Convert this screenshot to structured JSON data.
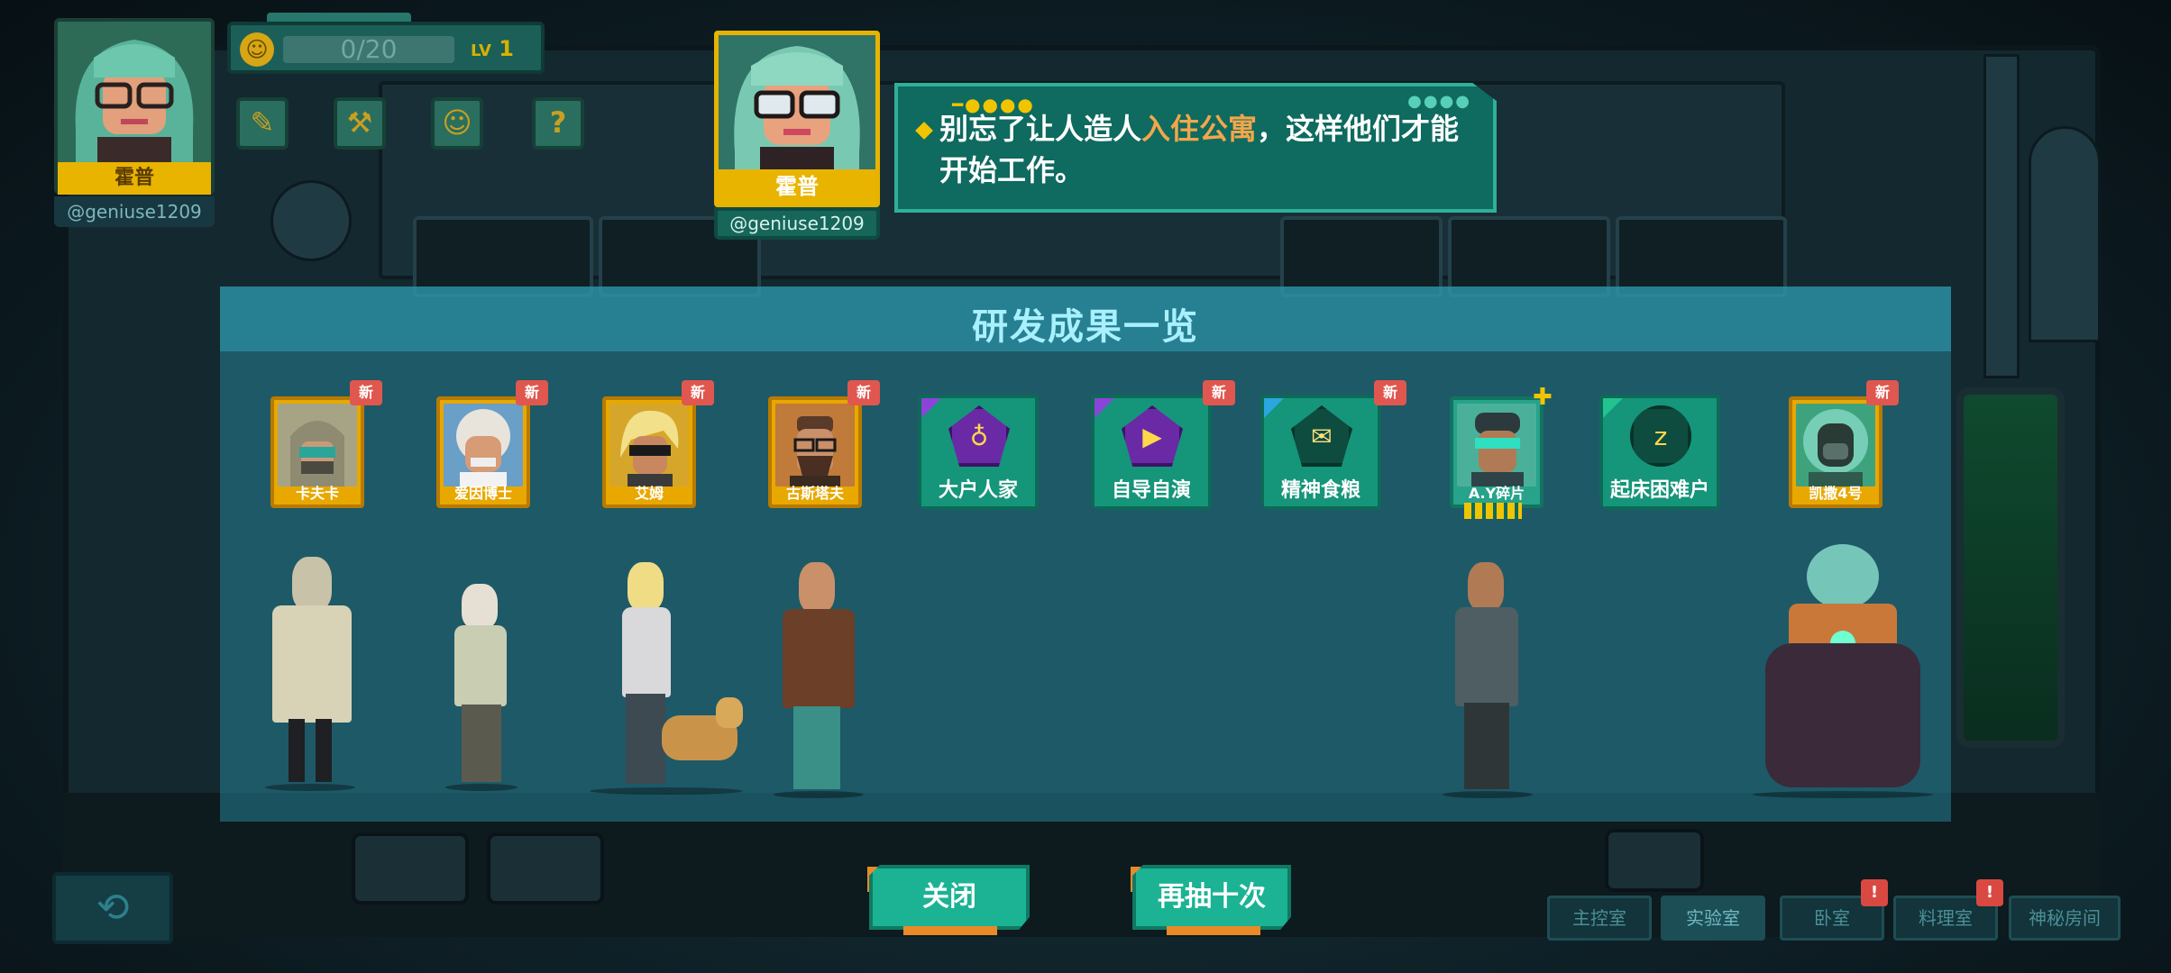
{
  "player": {
    "name": "霍普",
    "handle": "@geniuse1209",
    "xp_text": "0/20",
    "level_label": "LV",
    "level_value": "1"
  },
  "hud_buttons": [
    {
      "name": "notes-icon",
      "glyph": "✎"
    },
    {
      "name": "hammer-icon",
      "glyph": "⚒"
    },
    {
      "name": "smile-icon",
      "glyph": "☺"
    },
    {
      "name": "help-icon",
      "glyph": "?"
    }
  ],
  "speaker": {
    "name": "霍普",
    "handle": "@geniuse1209"
  },
  "dialog": {
    "text_before": "别忘了让人造人",
    "highlight": "入住公寓",
    "text_after": "，这样他们才能开始工作。"
  },
  "panel": {
    "title": "研发成果一览"
  },
  "results": [
    {
      "kind": "character",
      "label": "卡夫卡",
      "is_new": true,
      "new_label": "新",
      "color": "#8a8f7a"
    },
    {
      "kind": "character",
      "label": "爱因博士",
      "is_new": true,
      "new_label": "新",
      "color": "#c9a27a"
    },
    {
      "kind": "character",
      "label": "艾姆",
      "is_new": true,
      "new_label": "新",
      "color": "#d8b640"
    },
    {
      "kind": "character",
      "label": "古斯塔夫",
      "is_new": true,
      "new_label": "新",
      "color": "#6b4a3a"
    },
    {
      "kind": "trait",
      "label": "大户人家",
      "is_new": false,
      "glyph": "♁",
      "corner": "purple"
    },
    {
      "kind": "trait",
      "label": "自导自演",
      "is_new": true,
      "new_label": "新",
      "glyph": "▶",
      "corner": "purple"
    },
    {
      "kind": "trait",
      "label": "精神食粮",
      "is_new": true,
      "new_label": "新",
      "glyph": "✉",
      "corner": "blue"
    },
    {
      "kind": "character",
      "label": "A.Y碎片",
      "is_new": false,
      "color": "#3f8f86"
    },
    {
      "kind": "trait",
      "label": "起床困难户",
      "is_new": false,
      "glyph": "z",
      "corner": "green"
    },
    {
      "kind": "character",
      "label": "凯撒4号",
      "is_new": true,
      "new_label": "新",
      "color": "#3a7a5a"
    }
  ],
  "buttons": {
    "close": "关闭",
    "draw_ten": "再抽十次"
  },
  "corner_button": {
    "icon": "globe-return-icon",
    "glyph": "⟲"
  },
  "rooms": [
    {
      "label": "主控室",
      "alert": false
    },
    {
      "label": "实验室",
      "alert": false
    },
    {
      "label": "卧室",
      "alert": true,
      "alert_label": "!"
    },
    {
      "label": "料理室",
      "alert": true,
      "alert_label": "!"
    },
    {
      "label": "神秘房间",
      "alert": false
    }
  ]
}
